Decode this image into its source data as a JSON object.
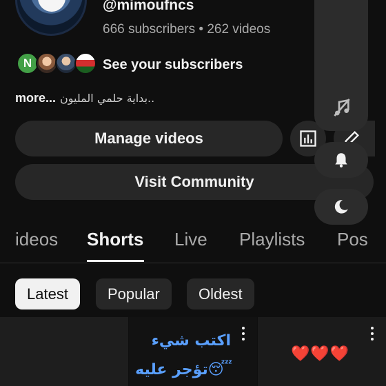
{
  "channel": {
    "handle": "@mimoufncs",
    "stats": "666 subscribers • 262 videos",
    "see_subscribers": "See your subscribers",
    "subscriber_avatar_initial": "N",
    "description_more": "more...",
    "description_text": "بداية حلمي المليون.."
  },
  "buttons": {
    "manage_videos": "Manage videos",
    "visit_community": "Visit Community",
    "analytics_icon": "bar-chart-icon",
    "edit_icon": "pencil-icon"
  },
  "floating_controls": {
    "music_icon": "music-off-icon",
    "bell_icon": "bell-icon",
    "moon_icon": "moon-icon"
  },
  "tabs": [
    {
      "label": "ideos",
      "active": false
    },
    {
      "label": "Shorts",
      "active": true
    },
    {
      "label": "Live",
      "active": false
    },
    {
      "label": "Playlists",
      "active": false
    },
    {
      "label": "Pos",
      "active": false
    }
  ],
  "filters": [
    {
      "label": "Latest",
      "selected": true
    },
    {
      "label": "Popular",
      "selected": false
    },
    {
      "label": "Oldest",
      "selected": false
    }
  ],
  "shorts": [
    {
      "text": ""
    },
    {
      "line1": "اكتب شيء",
      "line2": "😴تؤجر عليه"
    },
    {
      "text": "❤️❤️❤️"
    }
  ],
  "colors": {
    "background": "#0f0f0f",
    "button": "#272727",
    "selected_chip": "#f1f1f1",
    "arabic_text": "#5aa0ff"
  }
}
